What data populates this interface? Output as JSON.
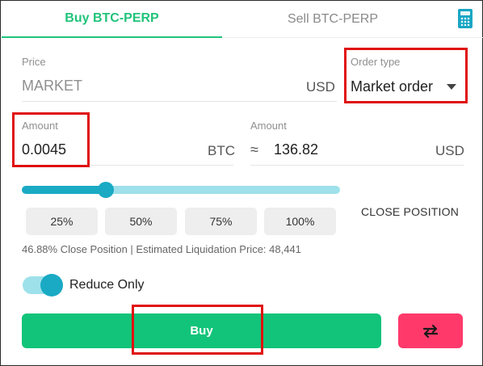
{
  "tabs": {
    "buy_label": "Buy BTC-PERP",
    "sell_label": "Sell BTC-PERP"
  },
  "icons": {
    "calculator": "calculator-icon",
    "swap": "swap-arrows-icon",
    "caret": "chevron-down-icon"
  },
  "price": {
    "label": "Price",
    "value": "MARKET",
    "unit": "USD"
  },
  "order_type": {
    "label": "Order type",
    "selected": "Market order"
  },
  "amount": {
    "label": "Amount",
    "value": "0.0045",
    "unit": "BTC"
  },
  "amount_usd": {
    "label": "Amount",
    "approx": "≈",
    "value": "136.82",
    "unit": "USD"
  },
  "slider": {
    "percent": 25
  },
  "percent_buttons": [
    "25%",
    "50%",
    "75%",
    "100%"
  ],
  "close_position_label": "CLOSE POSITION",
  "info_text": "46.88% Close Position | Estimated Liquidation Price: 48,441",
  "reduce_only": {
    "label": "Reduce Only",
    "enabled": true
  },
  "actions": {
    "buy_label": "Buy"
  },
  "colors": {
    "accent_green": "#20c47a",
    "buy_button": "#12c47a",
    "slider": "#1aaac4",
    "slider_track": "#9ee1ea",
    "swap_button": "#ff3a6b",
    "highlight_box": "#e01010"
  }
}
